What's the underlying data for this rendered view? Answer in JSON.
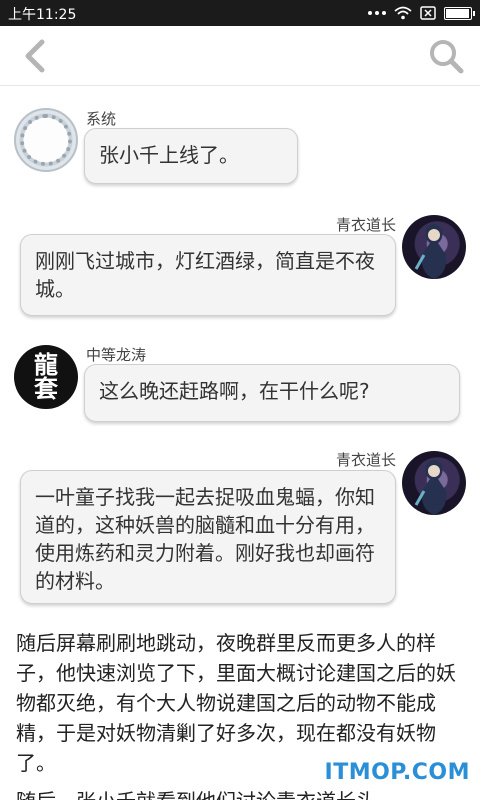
{
  "status_bar": {
    "time": "上午11:25",
    "battery_level": 0.9
  },
  "app_bar": {
    "back_icon": "chevron-left-icon",
    "search_icon": "search-icon"
  },
  "messages": [
    {
      "sender": "系统",
      "text": "张小千上线了。",
      "side": "left",
      "avatar": "system-avatar"
    },
    {
      "sender": "青衣道长",
      "text": "刚刚飞过城市，灯红酒绿，简直是不夜城。",
      "side": "right",
      "avatar": "taoist-avatar"
    },
    {
      "sender": "中等龙涛",
      "text": "这么晚还赶路啊，在干什么呢?",
      "side": "left",
      "avatar": "dragon-avatar",
      "avatar_text": [
        "龍",
        "套"
      ]
    },
    {
      "sender": "青衣道长",
      "text": "一叶童子找我一起去捉吸血鬼蝠，你知道的，这种妖兽的脑髓和血十分有用，使用炼药和灵力附着。刚好我也却画符的材料。",
      "side": "right",
      "avatar": "taoist-avatar"
    }
  ],
  "story": {
    "paragraph_1": "随后屏幕刷刷地跳动，夜晚群里反而更多人的样子，他快速浏览了下，里面大概讨论建国之后的妖物都灭绝，有个大人物说建国之后的动物不能成精，于是对妖物清剿了好多次，现在都没有妖物了。",
    "paragraph_2": "随后，张小千就看到他们讨论青衣道长头"
  },
  "watermark": "ITMOP.COM"
}
